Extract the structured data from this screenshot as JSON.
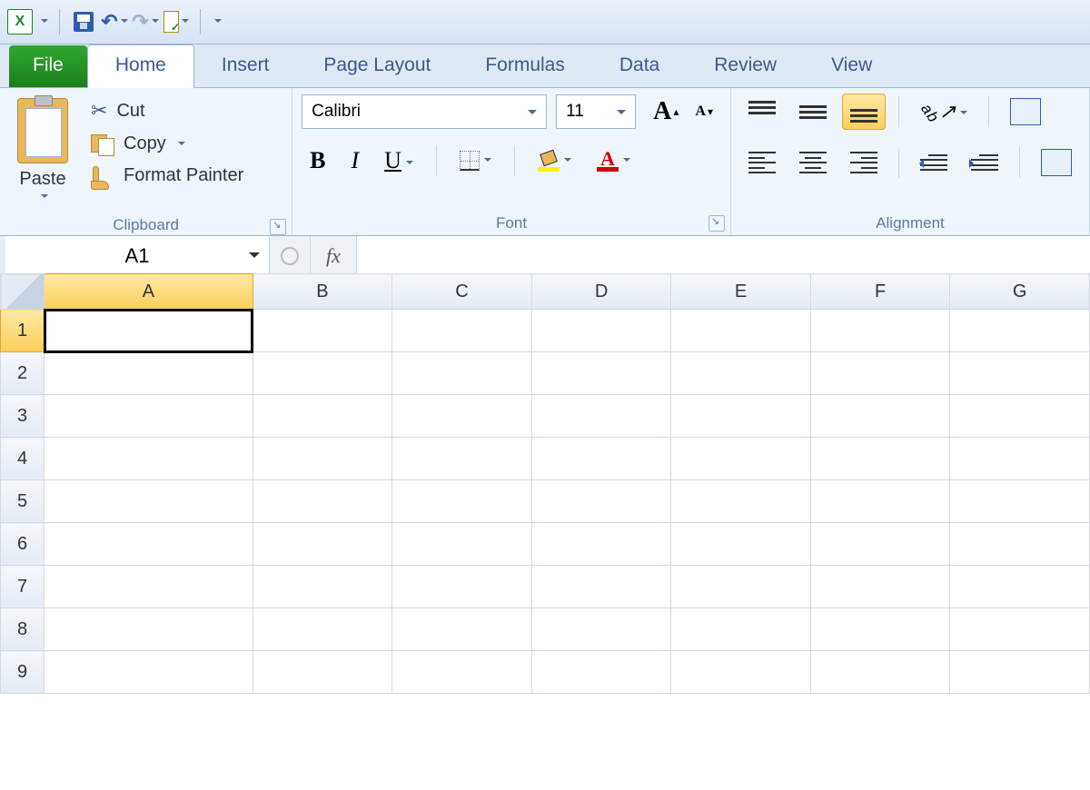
{
  "qat": {
    "app_icon": "X"
  },
  "tabs": {
    "file": "File",
    "home": "Home",
    "insert": "Insert",
    "page_layout": "Page Layout",
    "formulas": "Formulas",
    "data": "Data",
    "review": "Review",
    "view": "View"
  },
  "ribbon": {
    "clipboard": {
      "label": "Clipboard",
      "paste": "Paste",
      "cut": "Cut",
      "copy": "Copy",
      "format_painter": "Format Painter"
    },
    "font": {
      "label": "Font",
      "name": "Calibri",
      "size": "11",
      "bold": "B",
      "italic": "I",
      "underline": "U"
    },
    "alignment": {
      "label": "Alignment"
    }
  },
  "formula_bar": {
    "name_box": "A1",
    "fx": "fx",
    "value": ""
  },
  "grid": {
    "columns": [
      "A",
      "B",
      "C",
      "D",
      "E",
      "F",
      "G"
    ],
    "rows": [
      "1",
      "2",
      "3",
      "4",
      "5",
      "6",
      "7",
      "8",
      "9"
    ],
    "selected_cell": "A1",
    "selected_col": "A",
    "selected_row": "1"
  }
}
